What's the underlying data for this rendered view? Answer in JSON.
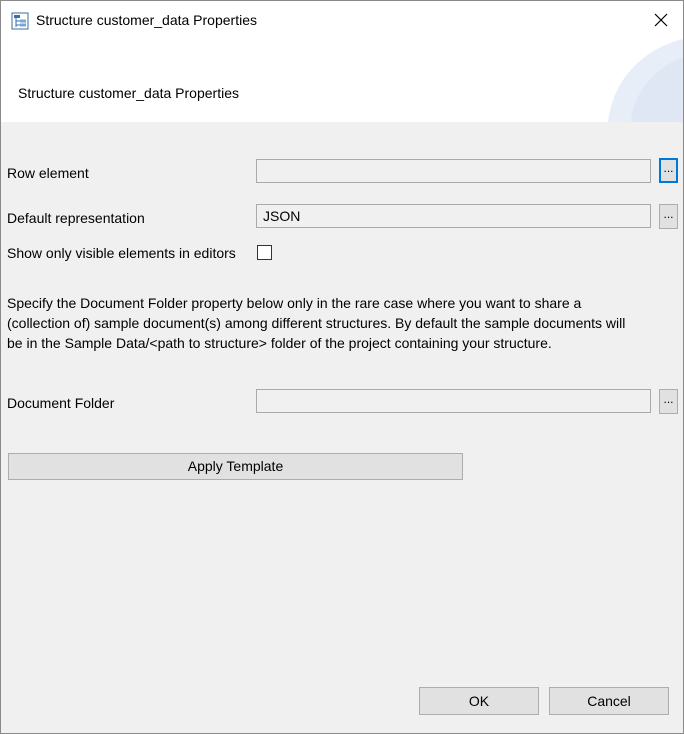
{
  "window": {
    "title": "Structure customer_data Properties",
    "close_icon": "close-icon",
    "app_icon": "structure-app-icon"
  },
  "banner": {
    "title": "Structure customer_data Properties"
  },
  "form": {
    "row_element": {
      "label": "Row element",
      "value": "",
      "browse_label": "..."
    },
    "default_representation": {
      "label": "Default representation",
      "value": "JSON",
      "browse_label": "..."
    },
    "show_visible": {
      "label": "Show only visible elements in editors",
      "checked": false
    },
    "description": [
      "Specify the Document Folder property below only in the rare case where you want to share a",
      "(collection of) sample document(s) among different structures.  By default the sample documents will",
      "be in the Sample Data/<path to structure> folder of the project containing your structure."
    ],
    "document_folder": {
      "label": "Document Folder",
      "value": "",
      "browse_label": "..."
    },
    "apply_template_label": "Apply Template"
  },
  "footer": {
    "ok_label": "OK",
    "cancel_label": "Cancel"
  },
  "colors": {
    "dialog_bg": "#f0f0f0",
    "focus_border": "#0078d7",
    "button_bg": "#e1e1e1"
  }
}
